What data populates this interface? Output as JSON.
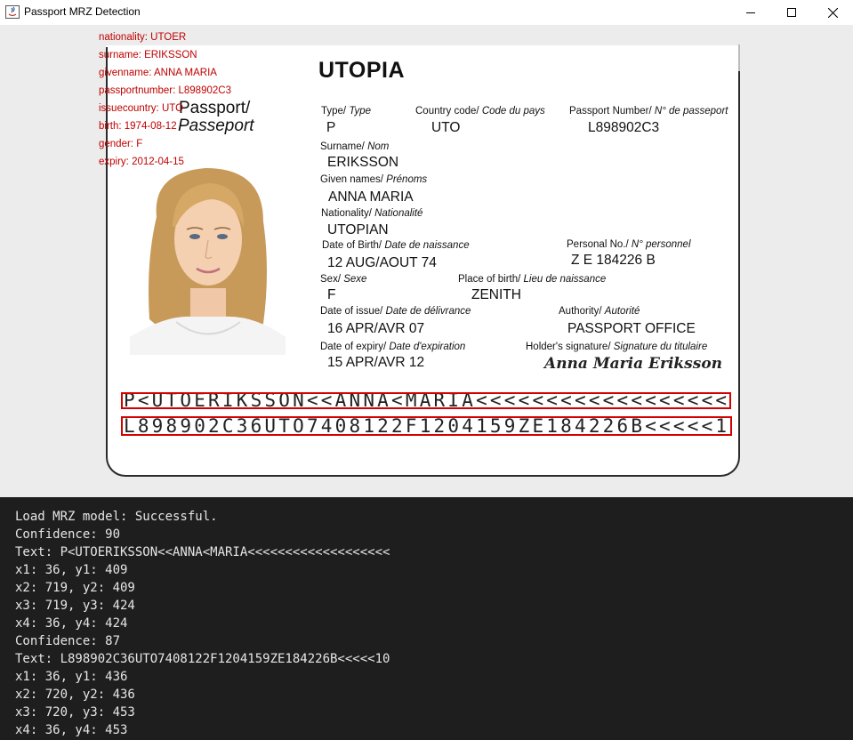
{
  "window": {
    "title": "Passport MRZ Detection",
    "buttons": [
      "minimize",
      "maximize",
      "close"
    ]
  },
  "overlay": {
    "lines": [
      "nationality: UTOER",
      "surname: ERIKSSON",
      "givenname: ANNA MARIA",
      "passportnumber: L898902C3",
      "issuecountry: UTO",
      "birth: 1974-08-12",
      "gender: F",
      "expiry: 2012-04-15"
    ]
  },
  "passport": {
    "country": "UTOPIA",
    "doc_kind_en": "Passport/",
    "doc_kind_fr": "Passeport",
    "fields": {
      "type": {
        "label": "Type/",
        "label_fr": "Type",
        "value": "P"
      },
      "country_code": {
        "label": "Country code/",
        "label_fr": "Code du pays",
        "value": "UTO"
      },
      "passport_number": {
        "label": "Passport Number/",
        "label_fr": "N° de passeport",
        "value": "L898902C3"
      },
      "surname": {
        "label": "Surname/",
        "label_fr": "Nom",
        "value": "ERIKSSON"
      },
      "given_names": {
        "label": "Given names/",
        "label_fr": "Prénoms",
        "value": "ANNA MARIA"
      },
      "nationality": {
        "label": "Nationality/",
        "label_fr": "Nationalité",
        "value": "UTOPIAN"
      },
      "date_of_birth": {
        "label": "Date of Birth/",
        "label_fr": "Date de naissance",
        "value": "12 AUG/AOUT 74"
      },
      "personal_no": {
        "label": "Personal No./",
        "label_fr": "N° personnel",
        "value": "Z E 184226 B"
      },
      "sex": {
        "label": "Sex/",
        "label_fr": "Sexe",
        "value": "F"
      },
      "place_of_birth": {
        "label": "Place of birth/",
        "label_fr": "Lieu de naissance",
        "value": "ZENITH"
      },
      "date_of_issue": {
        "label": "Date of issue/",
        "label_fr": "Date de délivrance",
        "value": "16 APR/AVR 07"
      },
      "authority": {
        "label": "Authority/",
        "label_fr": "Autorité",
        "value": "PASSPORT OFFICE"
      },
      "date_of_expiry": {
        "label": "Date of expiry/",
        "label_fr": "Date d'expiration",
        "value": "15 APR/AVR 12"
      },
      "signature": {
        "label": "Holder's signature/",
        "label_fr": "Signature du titulaire",
        "value": "Anna Maria Eriksson"
      }
    },
    "mrz": {
      "line1": "P<UTOERIKSSON<<ANNA<MARIA<<<<<<<<<<<<<<<<<<<",
      "line2": "L898902C36UTO7408122F1204159ZE184226B<<<<<10"
    }
  },
  "console": {
    "lines": [
      "Load MRZ model: Successful.",
      "Confidence: 90",
      "Text: P<UTOERIKSSON<<ANNA<MARIA<<<<<<<<<<<<<<<<<<<",
      "x1: 36, y1: 409",
      "x2: 719, y2: 409",
      "x3: 719, y3: 424",
      "x4: 36, y4: 424",
      "Confidence: 87",
      "Text: L898902C36UTO7408122F1204159ZE184226B<<<<<10",
      "x1: 36, y1: 436",
      "x2: 720, y2: 436",
      "x3: 720, y3: 453",
      "x4: 36, y4: 453"
    ]
  },
  "colors": {
    "overlay_text": "#c00000",
    "mrz_box": "#d40000",
    "console_bg": "#1e1e1e",
    "console_text": "#e6e6e6",
    "panel_bg": "#ececec"
  }
}
